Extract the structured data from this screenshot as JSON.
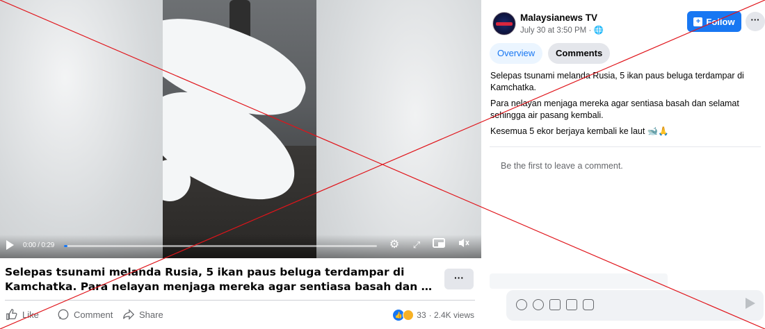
{
  "video": {
    "time": "0:00 / 0:29",
    "progress_fraction": 0.0
  },
  "caption": {
    "line1": "Selepas tsunami melanda Rusia, 5 ikan paus beluga terdampar di",
    "line2": "Kamchatka. Para nelayan menjaga mereka agar sentiasa basah dan selam…",
    "more": "···"
  },
  "actions": {
    "like": "Like",
    "comment": "Comment",
    "share": "Share",
    "reaction_count": "33",
    "views": "· 2.4K views"
  },
  "post": {
    "page_name": "Malaysianews TV",
    "meta": "July 30 at 3:50 PM ·",
    "follow_label": "Follow",
    "more_label": "···",
    "tabs": [
      "Overview",
      "Comments"
    ],
    "paragraphs": [
      "Selepas tsunami melanda Rusia, 5 ikan paus beluga terdampar di Kamchatka.",
      "Para nelayan menjaga mereka agar sentiasa basah dan selamat sehingga air pasang kembali.",
      "Kesemua 5 ekor berjaya kembali ke laut 🐋🙏"
    ],
    "no_comments": "Be the first to leave a comment."
  },
  "colors": {
    "brand": "#1877f2",
    "overlay_cross": "#e0141a"
  }
}
